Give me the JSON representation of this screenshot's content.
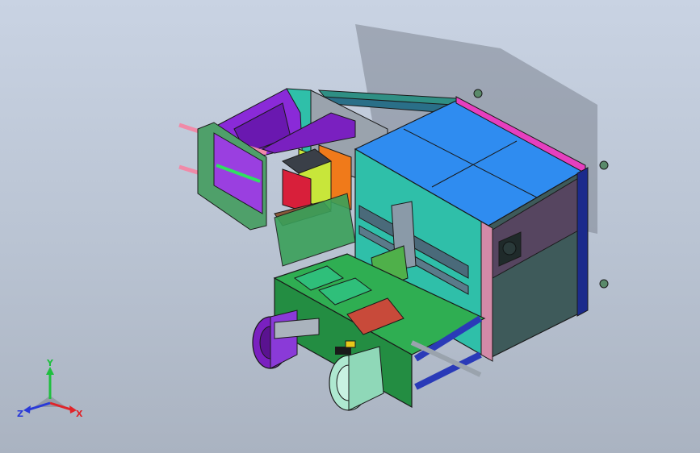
{
  "viewport": {
    "background_top": "#c9d3e3",
    "background_bottom": "#aab3c1"
  },
  "model": {
    "description_hidden": false,
    "palette": {
      "teal": "#2fbfa9",
      "teal_dark": "#1c8c7c",
      "blue_top": "#2f8cf0",
      "magenta": "#e63fbf",
      "navy": "#1b2a8c",
      "purple": "#8a2ad8",
      "green": "#2fae52",
      "violet": "#9a3fe0",
      "orange": "#f07a1a",
      "yellow_green": "#c8e63a",
      "red": "#d81f3a",
      "dark_panel": "#3e5a5a",
      "brown": "#8a5a3a",
      "pink_rod": "#f08aa8"
    }
  },
  "triad": {
    "y_label": "Y",
    "z_label": "Z",
    "x_label": "X",
    "y_color": "#1fbf3f",
    "x_color": "#e0242a",
    "z_color": "#2a3ad8"
  }
}
